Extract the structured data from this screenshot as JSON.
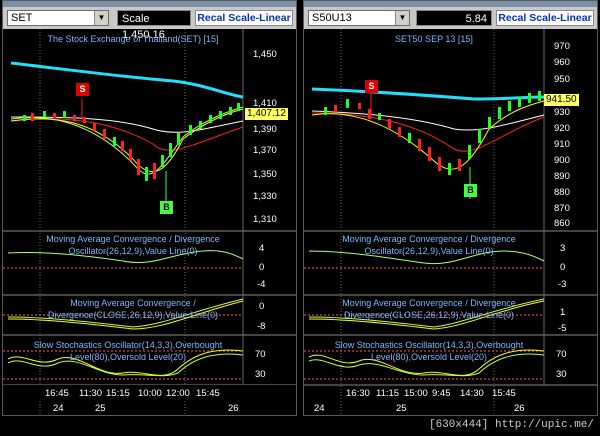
{
  "left": {
    "symbol": "SET",
    "scale_label": "Scale",
    "price": "1,450.16",
    "recal_label": "Recal Scale-Linear",
    "chart_title": "The Stock Exchange of Thailand(SET) [15]",
    "last_price": "1,407.12",
    "price_axis": [
      "1,450",
      "1,410",
      "1,370",
      "1,330",
      "1,310"
    ],
    "price_axis_extra": [
      "1,390",
      "1,350"
    ],
    "ind1": [
      "Moving Average Convergence / Divergence",
      "Oscillator(26,12,9),Value Line(0)"
    ],
    "ind1_axis": [
      "4",
      "0",
      "-4"
    ],
    "ind2": [
      "Moving Average Convergence /",
      "Divergence(CLOSE,26,12,9),Value Line(0)"
    ],
    "ind2_axis": [
      "0",
      "-8"
    ],
    "ind3": [
      "Slow Stochastics Oscillator(14,3,3),Overbought",
      "Level(80),Oversold Level(20)"
    ],
    "ind3_axis": [
      "70",
      "30"
    ],
    "times": [
      "16:45",
      "11:30",
      "15:15",
      "10:00",
      "12:00",
      "15:45"
    ],
    "dates": [
      "24",
      "25",
      "26"
    ]
  },
  "right": {
    "symbol": "S50U13",
    "price": "5.84",
    "recal_label": "Recal Scale-Linear",
    "chart_title": "SET50 SEP 13   [15]",
    "last_price": "941.50",
    "price_axis": [
      "970",
      "960",
      "950",
      "940",
      "930",
      "920",
      "910",
      "900",
      "890",
      "880",
      "870",
      "860"
    ],
    "ind1": [
      "Moving Average Convergence / Divergence",
      "Oscillator(26,12,9),Value Line(0)"
    ],
    "ind1_axis": [
      "3",
      "0",
      "-3"
    ],
    "ind2": [
      "Moving Average Convergence / Divergence",
      "Divergence(CLOSE,26,12,9),Value Line(0)"
    ],
    "ind2_axis": [
      "1",
      "-5"
    ],
    "ind3": [
      "Slow Stochastics Oscillator(14,3,3),Overbought",
      "Level(80),Oversold Level(20)"
    ],
    "ind3_axis": [
      "70",
      "30"
    ],
    "times": [
      "16:30",
      "11:15",
      "15:00",
      "9:45",
      "14:30",
      "15:45"
    ],
    "dates": [
      "24",
      "25",
      "26"
    ]
  },
  "signals": {
    "sell": "S",
    "buy": "B"
  },
  "footer": "[630x444] http://upic.me/",
  "colors": {
    "ma_fast": "#ffff00",
    "ma_mid": "#ff2020",
    "ma_slow": "#ffffff",
    "band": "#20e0ff",
    "candle_up": "#20ff20",
    "candle_down": "#ff2020",
    "label": "#7fb7ff"
  }
}
